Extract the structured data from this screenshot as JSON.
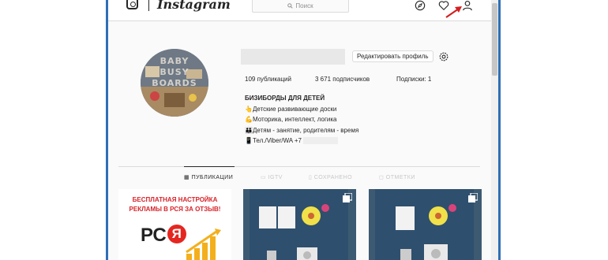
{
  "header": {
    "logo_text": "Instagram",
    "search_placeholder": "Поиск",
    "icons": [
      "compass-icon",
      "heart-icon",
      "user-icon"
    ]
  },
  "profile": {
    "avatar_text": [
      "BABY",
      "BUSY",
      "BOARDS"
    ],
    "edit_button": "Редактировать профиль",
    "stats": {
      "posts": "109 публикаций",
      "followers": "3 671 подписчиков",
      "following": "Подписки: 1"
    },
    "bio": {
      "name": "БИЗИБОРДЫ ДЛЯ ДЕТЕЙ",
      "line1": "Детские развивающие доски",
      "line2": "Моторика, интеллект, логика",
      "line3": "Детям - занятие, родителям - время",
      "line4": "Тел./Viber/WA +7"
    }
  },
  "tabs": [
    {
      "label": "ПУБЛИКАЦИИ",
      "active": true
    },
    {
      "label": "IGTV",
      "active": false
    },
    {
      "label": "СОХРАНЕНО",
      "active": false
    },
    {
      "label": "ОТМЕТКИ",
      "active": false
    }
  ],
  "posts": {
    "ad": {
      "line1": "БЕСПЛАТНАЯ НАСТРОЙКА",
      "line2": "РЕКЛАМЫ В РСЯ ЗА ОТЗЫВ!",
      "logo_main": "РС",
      "logo_letter": "Я"
    }
  },
  "colors": {
    "accent_red": "#d8232a",
    "window_frame": "#2e6fb6",
    "text": "#262626",
    "border": "#dbdbdb"
  }
}
